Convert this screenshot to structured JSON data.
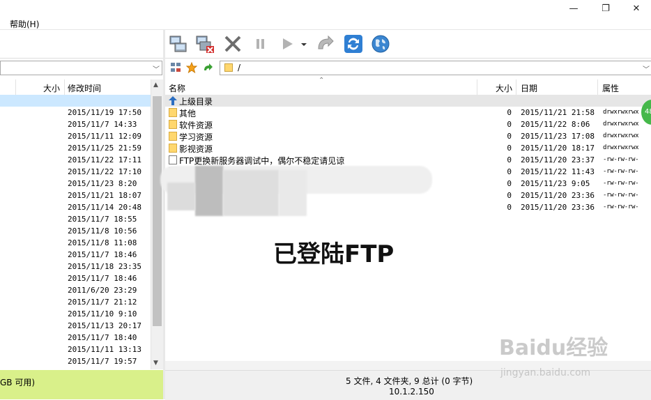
{
  "window": {
    "controls": {
      "minimize": "—",
      "restore": "❐",
      "close": "✕"
    }
  },
  "menu": {
    "items": [
      "帮助(H)"
    ]
  },
  "left_pane": {
    "columns": {
      "size": "大小",
      "modified": "修改时间"
    },
    "rows": [
      "",
      "2015/11/19 17:50",
      "2015/11/7 14:33",
      "2015/11/11 12:09",
      "2015/11/25 21:59",
      "2015/11/22 17:11",
      "2015/11/22 17:10",
      "2015/11/23 8:20",
      "2015/11/21 18:07",
      "2015/11/14 20:48",
      "2015/11/7 18:55",
      "2015/11/8 10:56",
      "2015/11/8 11:08",
      "2015/11/7 18:46",
      "2015/11/18 23:35",
      "2015/11/7 18:46",
      "2011/6/20 23:29",
      "2015/11/7 21:12",
      "2015/11/10 9:10",
      "2015/11/13 20:17",
      "2015/11/7 18:40",
      "2015/11/11 13:13",
      "2015/11/7 19:57"
    ],
    "status": "GB 可用)"
  },
  "right_pane": {
    "path": "/",
    "columns": {
      "name": "名称",
      "size": "大小",
      "date": "日期",
      "attr": "属性"
    },
    "up_label": "上级目录",
    "rows": [
      {
        "type": "folder",
        "name": "其他",
        "size": "0",
        "date": "2015/11/21 21:58",
        "attr": "drwxrwxrwx"
      },
      {
        "type": "folder",
        "name": "软件资源",
        "size": "0",
        "date": "2015/11/22 8:06",
        "attr": "drwxrwxrwx"
      },
      {
        "type": "folder",
        "name": "学习资源",
        "size": "0",
        "date": "2015/11/23 17:08",
        "attr": "drwxrwxrwx"
      },
      {
        "type": "folder",
        "name": "影视资源",
        "size": "0",
        "date": "2015/11/20 18:17",
        "attr": "drwxrwxrwx"
      },
      {
        "type": "file",
        "name": "FTP更换新服务器调试中，偶尔不稳定请见谅",
        "size": "0",
        "date": "2015/11/20 23:37",
        "attr": "-rw-rw-rw-"
      },
      {
        "type": "file",
        "name": "",
        "size": "0",
        "date": "2015/11/22 11:43",
        "attr": "-rw-rw-rw-"
      },
      {
        "type": "file",
        "name": "",
        "size": "0",
        "date": "2015/11/23 9:05",
        "attr": "-rw-rw-rw-"
      },
      {
        "type": "file",
        "name": "",
        "size": "0",
        "date": "2015/11/20 23:36",
        "attr": "-rw-rw-rw-"
      },
      {
        "type": "file",
        "name": "",
        "size": "0",
        "date": "2015/11/20 23:36",
        "attr": "-rw-rw-rw-"
      }
    ],
    "status_summary": "5 文件, 4 文件夹, 9 总计 (0 字节)",
    "status_ip": "10.1.2.150"
  },
  "overlay_text": "已登陆FTP",
  "badge_text": "48",
  "watermark": {
    "line1": "Baidu经验",
    "line2": "jingyan.baidu.com"
  },
  "colors": {
    "status_green": "#d9f08a",
    "selection": "#cce8ff",
    "folder": "#ffd76e"
  }
}
